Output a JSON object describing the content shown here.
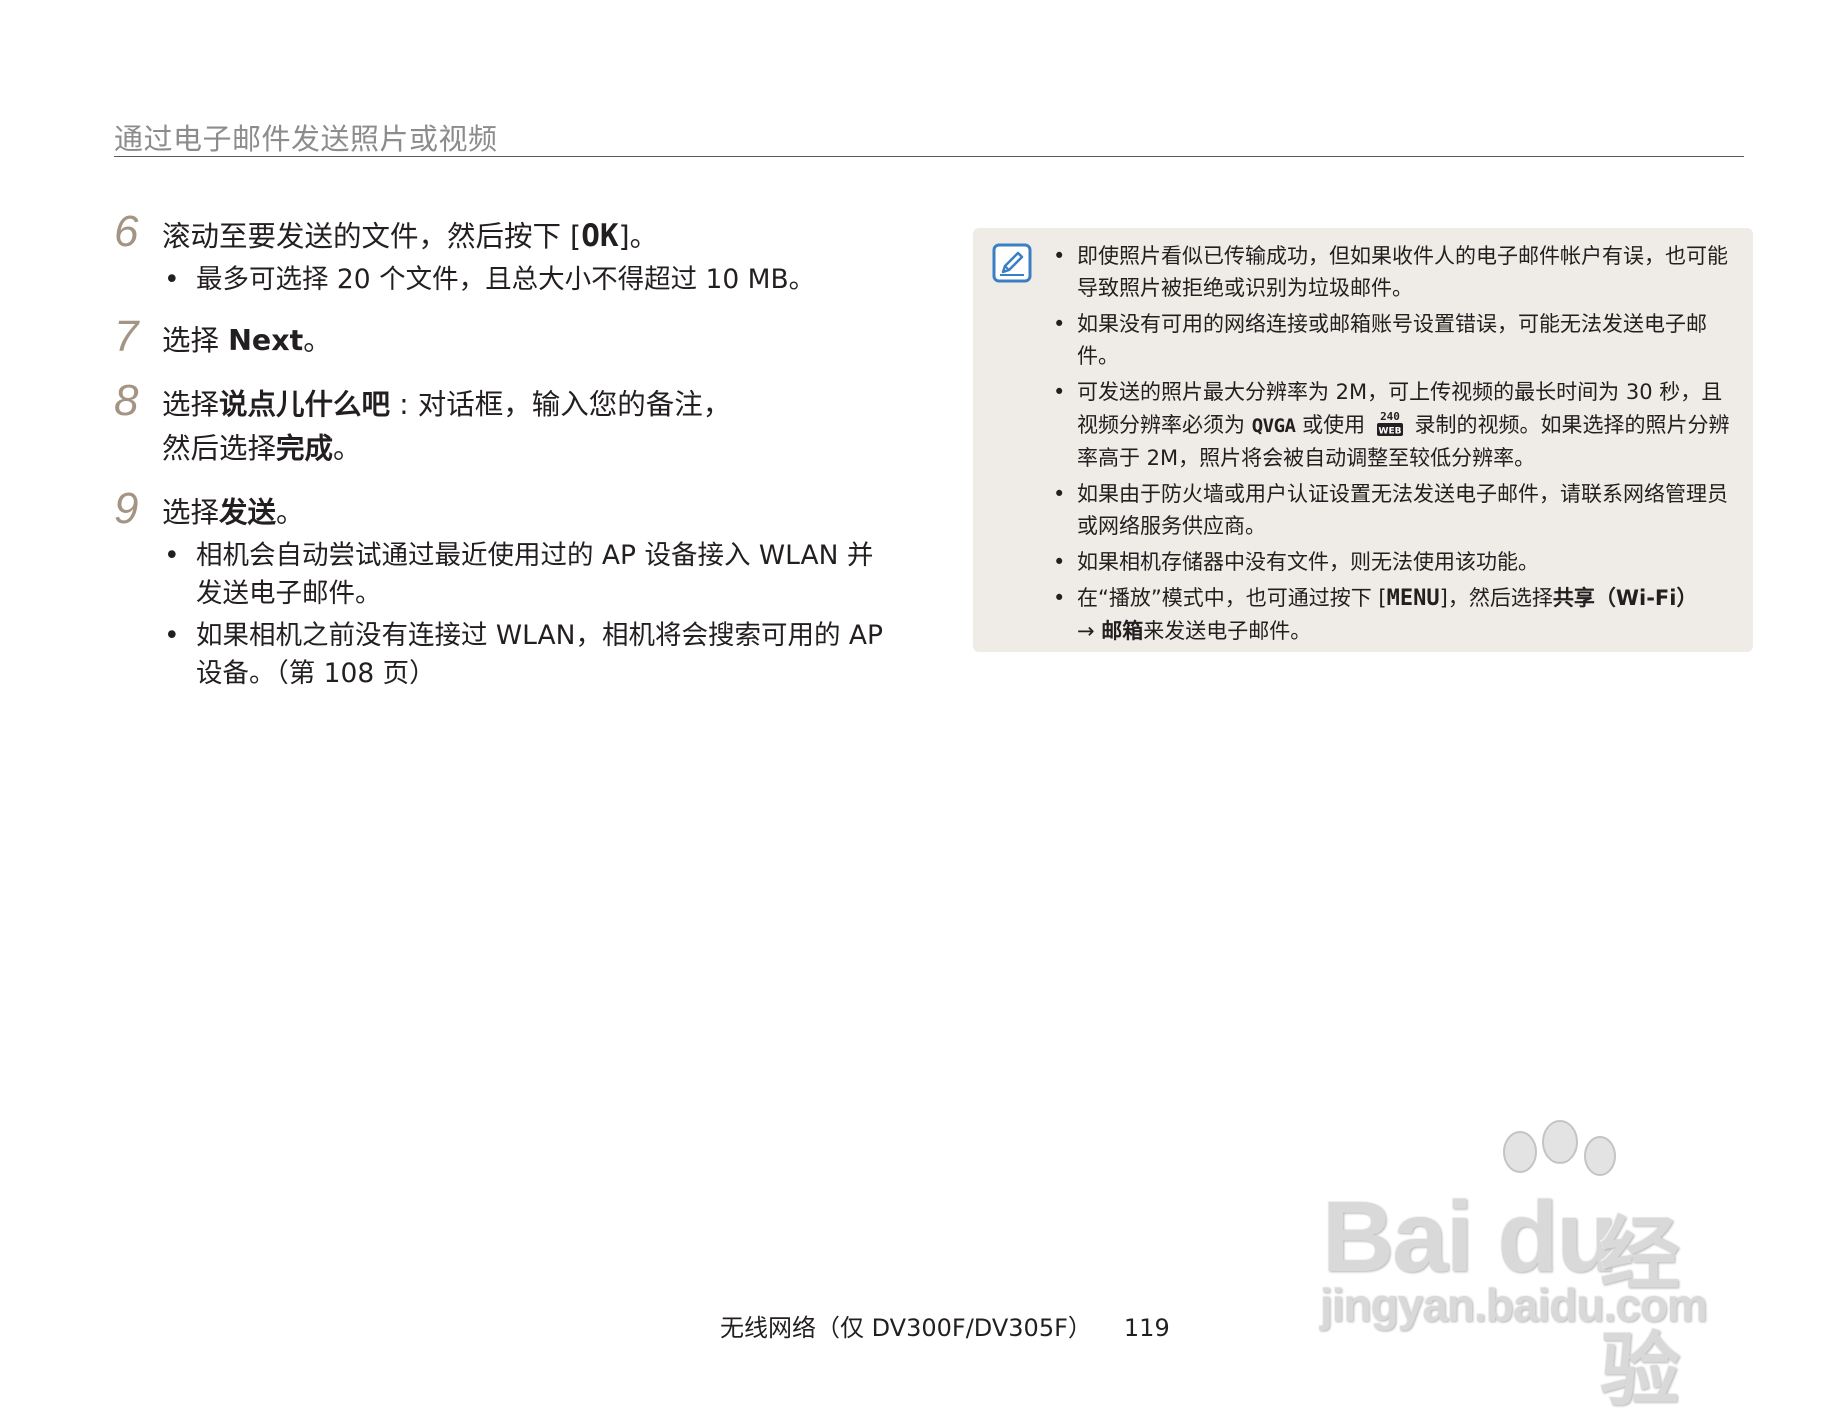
{
  "header": {
    "title": "通过电子邮件发送照片或视频"
  },
  "steps": [
    {
      "number": "6",
      "text_pre": "滚动至要发送的文件，然后按下 [",
      "key": "OK",
      "text_post": "]。",
      "subs": [
        "最多可选择 20 个文件，且总大小不得超过 10 MB。"
      ]
    },
    {
      "number": "7",
      "text_pre": "选择 ",
      "bold": "Next",
      "text_post": "。"
    },
    {
      "number": "8",
      "text_pre": "选择",
      "bold": "说点儿什么吧",
      "text_mid": " : 对话框，输入您的备注，",
      "line2_pre": "然后选择",
      "line2_bold": "完成",
      "line2_post": "。"
    },
    {
      "number": "9",
      "text_pre": "选择",
      "bold": "发送",
      "text_post": "。",
      "subs": [
        "相机会自动尝试通过最近使用过的 AP 设备接入 WLAN 并发送电子邮件。",
        "如果相机之前没有连接过 WLAN，相机将会搜索可用的 AP 设备。（第 108 页）"
      ]
    }
  ],
  "note": {
    "icon": "note-pencil-icon",
    "items": [
      "即使照片看似已传输成功，但如果收件人的电子邮件帐户有误，也可能导致照片被拒绝或识别为垃圾邮件。",
      "如果没有可用的网络连接或邮箱账号设置错误，可能无法发送电子邮件。",
      {
        "part1": "可发送的照片最大分辨率为 2M，可上传视频的最长时间为 30 秒，且视频分辨率必须为 ",
        "qvga": "QVGA",
        "part2": " 或使用 ",
        "icon_top": "240",
        "icon_bottom": "WEB",
        "part3": " 录制的视频。如果选择的照片分辨率高于 2M，照片将会被自动调整至较低分辨率。"
      },
      "如果由于防火墙或用户认证设置无法发送电子邮件，请联系网络管理员或网络服务供应商。",
      "如果相机存储器中没有文件，则无法使用该功能。",
      {
        "part1": "在“播放”模式中，也可通过按下 [",
        "key": "MENU",
        "part2": "]，然后选择",
        "bold1": "共享（Wi-Fi）",
        "part3": "→ ",
        "bold2": "邮箱",
        "part4": "来发送电子邮件。"
      }
    ]
  },
  "footer": {
    "section": "无线网络（仅 DV300F/DV305F）",
    "page": "119"
  },
  "watermark": {
    "brand": "Bai du",
    "cn": "经验",
    "url": "jingyan.baidu.com"
  }
}
